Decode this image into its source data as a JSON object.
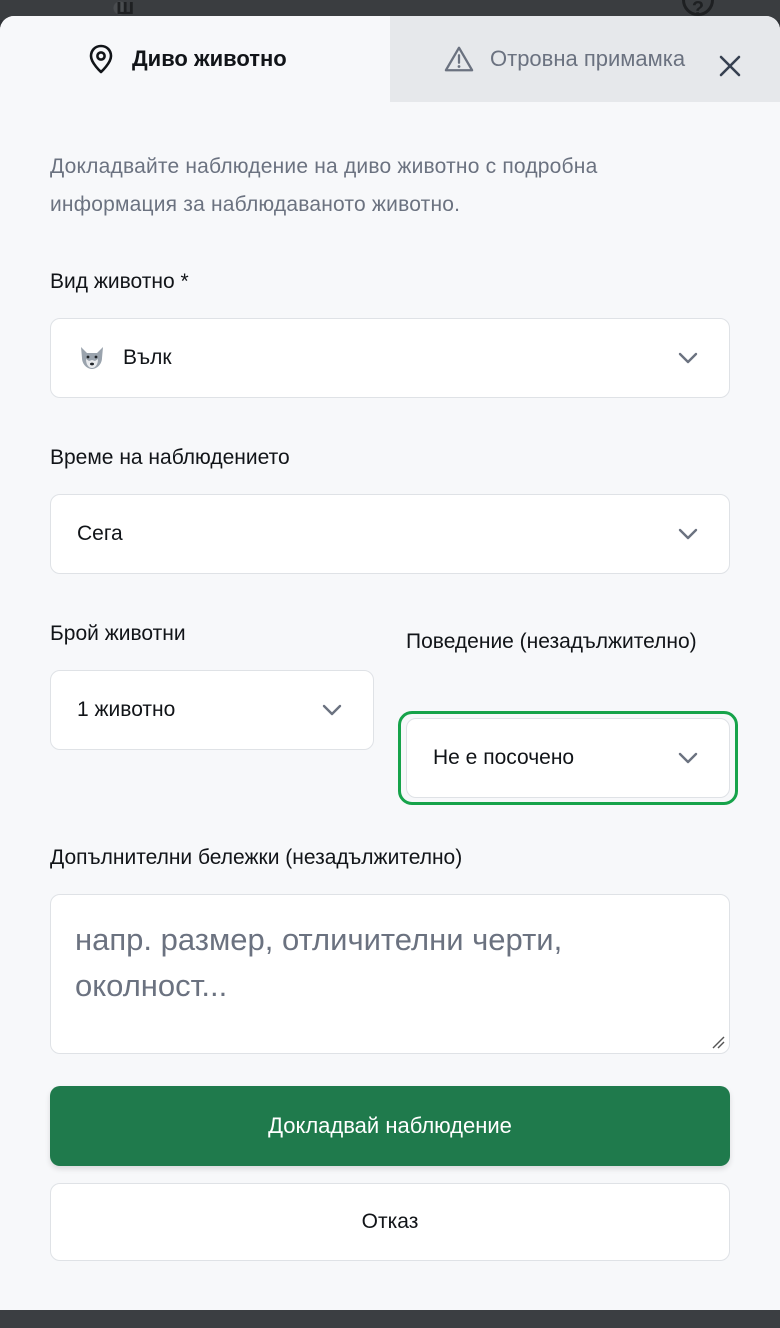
{
  "tabs": [
    {
      "label": "Диво животно",
      "icon": "map-pin-icon",
      "active": true
    },
    {
      "label": "Отровна примамка",
      "icon": "warning-triangle-icon",
      "active": false
    }
  ],
  "description": "Докладвайте наблюдение на диво животно с подробна информация за наблюдаваното животно.",
  "fields": {
    "species": {
      "label": "Вид животно *",
      "value": "Вълк",
      "icon": "wolf-icon"
    },
    "time": {
      "label": "Време на наблюдението",
      "value": "Сега"
    },
    "count": {
      "label": "Брой животни",
      "value": "1 животно"
    },
    "behavior": {
      "label": "Поведение (незадължително)",
      "value": "Не е посочено"
    },
    "notes": {
      "label": "Допълнителни бележки (незадължително)",
      "placeholder": "напр. размер, отличителни черти, околност..."
    }
  },
  "buttons": {
    "submit": "Докладвай наблюдение",
    "cancel": "Отказ"
  },
  "colors": {
    "primary": "#1f7a4c",
    "focus": "#16a34a",
    "muted_text": "#6b7280",
    "modal_bg": "#f7f8fa",
    "inactive_tab_bg": "#e6e8eb"
  }
}
